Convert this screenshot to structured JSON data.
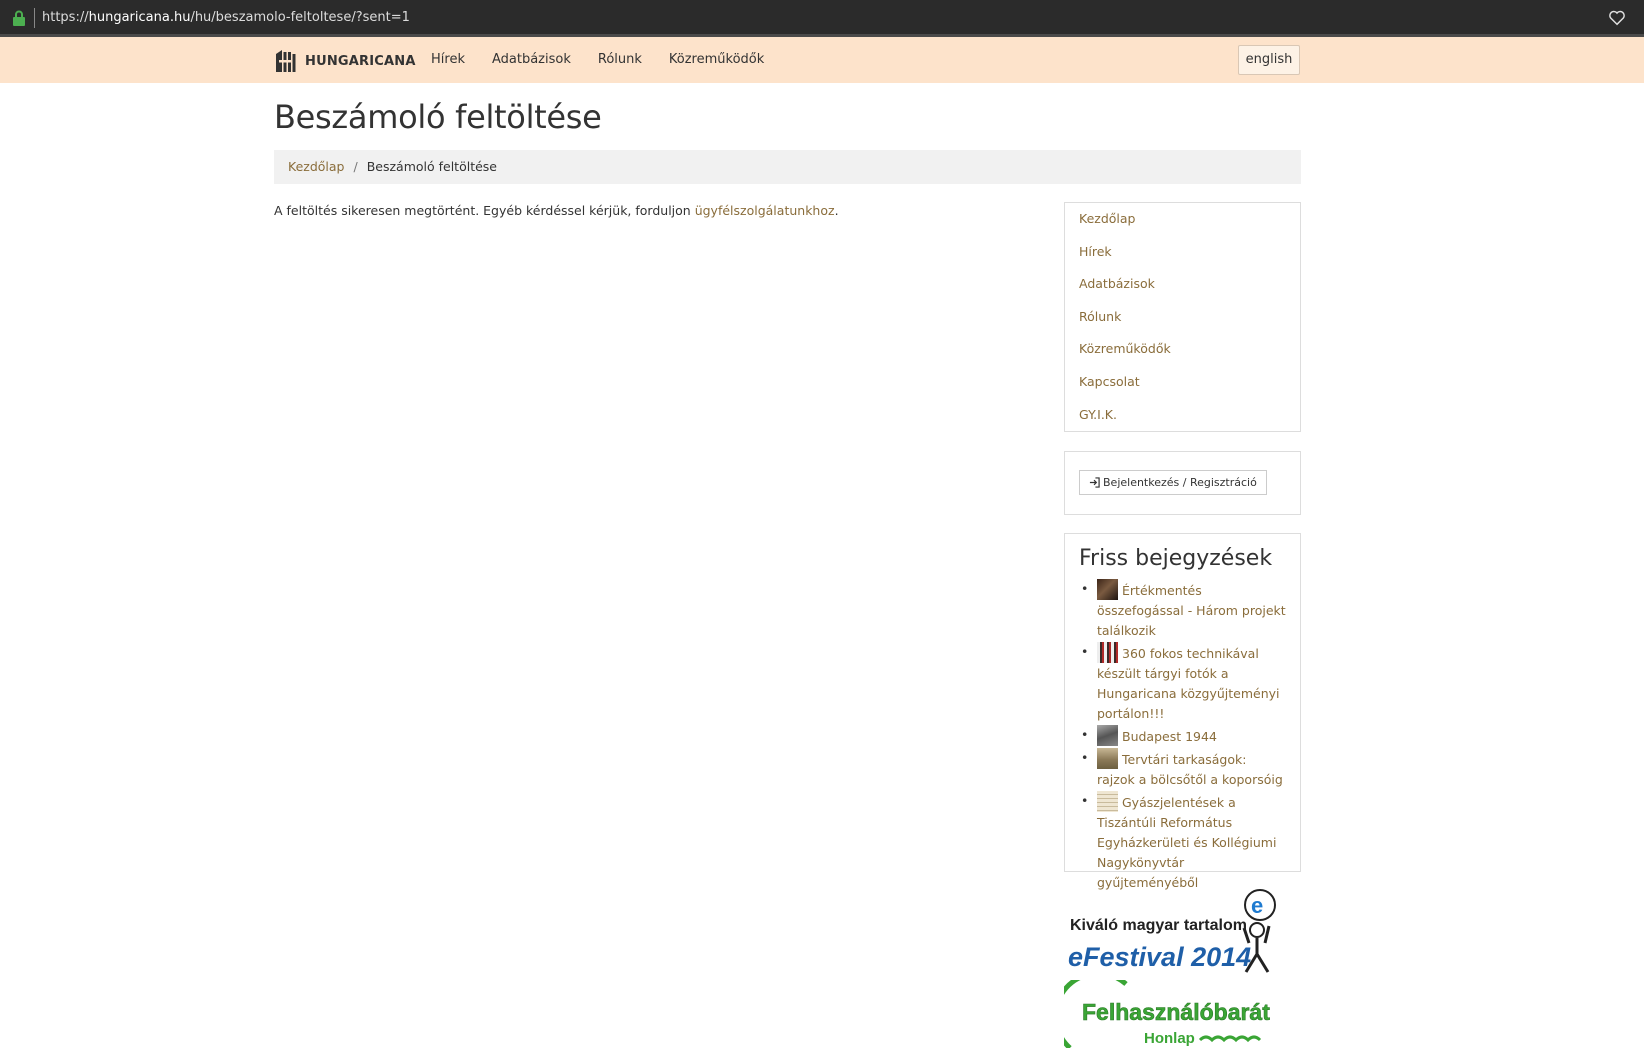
{
  "browser": {
    "url_prefix": "https://",
    "url_domain": "hungaricana.hu",
    "url_path": "/hu/beszamolo-feltoltese/?sent=1"
  },
  "navbar": {
    "brand": "HUNGARICANA",
    "links": [
      "Hírek",
      "Adatbázisok",
      "Rólunk",
      "Közreműködők"
    ],
    "lang_button": "english"
  },
  "page": {
    "title": "Beszámoló feltöltése"
  },
  "breadcrumb": {
    "home": "Kezdőlap",
    "separator": "/",
    "current": "Beszámoló feltöltése"
  },
  "message": {
    "text": "A feltöltés sikeresen megtörtént. Egyéb kérdéssel kérjük, forduljon ",
    "link": "ügyfélszolgálatunkhoz",
    "end": "."
  },
  "sidebar": {
    "menu": [
      "Kezdőlap",
      "Hírek",
      "Adatbázisok",
      "Rólunk",
      "Közreműködők",
      "Kapcsolat",
      "GY.I.K."
    ],
    "login_button": "Bejelentkezés / Regisztráció",
    "recent_title": "Friss bejegyzések",
    "recent_posts": [
      "Értékmentés összefogással - Három projekt találkozik",
      "360 fokos technikával készült tárgyi fotók a Hungaricana közgyűjteményi portálon!!!",
      "Budapest 1944",
      "Tervtári tarkaságok: rajzok a bölcsőtől a koporsóig",
      "Gyászjelentések a Tiszántúli Református Egyházkerületi és Kollégiumi Nagykönyvtár gyűjteményéből"
    ]
  },
  "badges": {
    "efestival_line1": "Kiváló magyar tartalom",
    "efestival_line2": "eFestival 2014",
    "friendly_line1": "Felhasználóbarát",
    "friendly_line2": "Honlap"
  },
  "colors": {
    "navbar_bg": "#fde3cb",
    "link": "#8a6d3b",
    "breadcrumb_bg": "#f1f1f1"
  }
}
